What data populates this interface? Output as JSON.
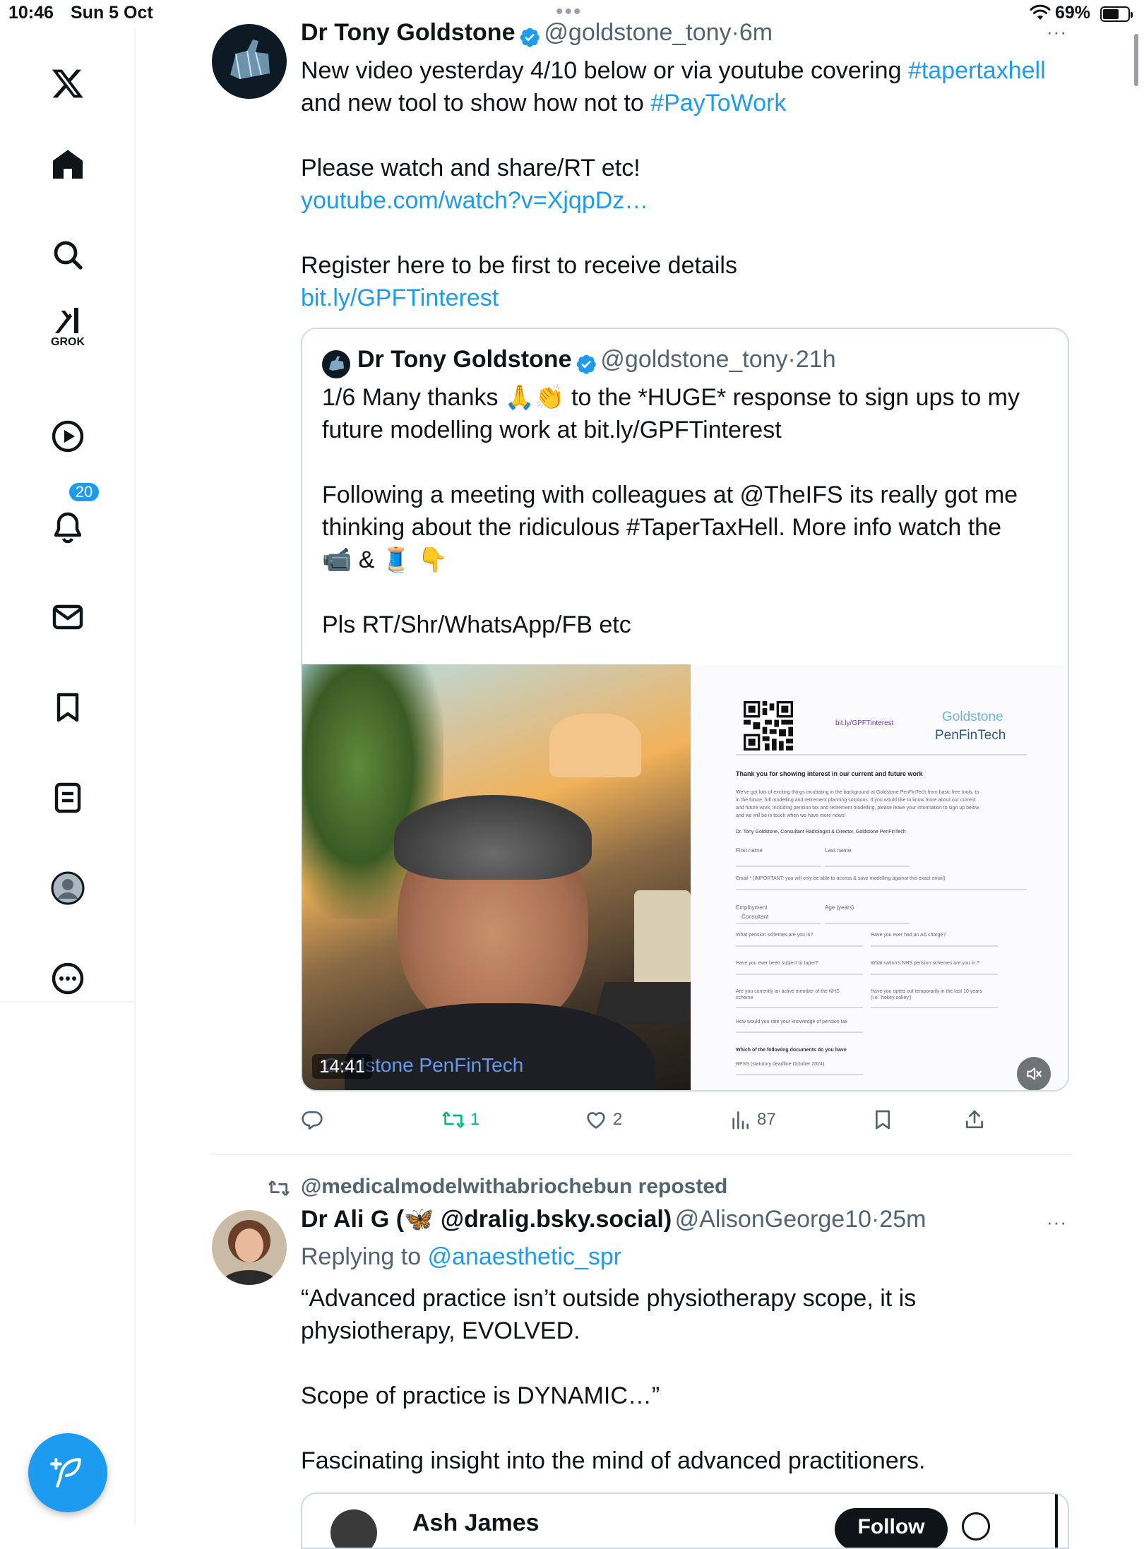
{
  "status_bar": {
    "time": "10:46",
    "date": "Sun 5 Oct",
    "battery": "69%",
    "battery_level": 0.69
  },
  "sidebar": {
    "items": [
      {
        "name": "x-logo"
      },
      {
        "name": "home"
      },
      {
        "name": "search"
      },
      {
        "name": "grok",
        "label": "GROK"
      },
      {
        "name": "video"
      },
      {
        "name": "notifications",
        "badge": "20"
      },
      {
        "name": "messages"
      },
      {
        "name": "bookmarks"
      },
      {
        "name": "lists"
      },
      {
        "name": "profile"
      },
      {
        "name": "more"
      }
    ]
  },
  "tweet1": {
    "name": "Dr Tony Goldstone",
    "handle": "@goldstone_tony",
    "sep": "·",
    "time": "6m",
    "more": "···",
    "line1": "New video yesterday 4/10 below or via youtube covering ",
    "hashtag1": "#tapertaxhell",
    "line2": "and new tool to show how not to ",
    "hashtag2": "#PayToWork",
    "line3": "Please watch and share/RT etc!",
    "link1": "youtube.com/watch?v=XjqpDz…",
    "line4": "Register here to be first to receive details",
    "link2": "bit.ly/GPFTinterest",
    "quote": {
      "name": "Dr Tony Goldstone",
      "handle": "@goldstone_tony",
      "sep": "·",
      "time": "21h",
      "p1a": "1/6 Many thanks 🙏👏 to the *HUGE* response to sign ups to my",
      "p1b": "future modelling work at bit.ly/GPFTinterest",
      "p2a": "Following a meeting with colleagues at @TheIFS its really got me",
      "p2b": "thinking about the ridiculous #TaperTaxHell. More info watch the",
      "p2c": "📹 & 🧵 👇",
      "p3": "Pls RT/Shr/WhatsApp/FB etc",
      "video_duration": "14:41",
      "video_watermark": "Goldstone PenFinTech",
      "form": {
        "qr_link": "bit.ly/GPFTinterest",
        "brand1": "Goldstone",
        "brand2": "PenFinTech",
        "heading": "Thank you for showing interest in our current and future work",
        "intro1": "We've got lots of exciting things incubating in the background at Goldstone PenFinTech from basic free tools, to",
        "intro2": "in the future, full modelling and retirement planning solutions. If you would like to know more about our current",
        "intro3": "and future work, including pension tax and retirement modelling, please leave your information to sign up below",
        "intro4": "and we will be in touch when we have more news!",
        "signature": "Dr. Tony Goldstone, Consultant Radiologist & Director, Goldstone PenFinTech",
        "first_name": "First name",
        "last_name": "Last name",
        "email": "Email * (IMPORTANT: you will only be able to access & save modelling against this exact email)",
        "employment": "Employment",
        "employment_value": "Consultant",
        "age": "Age (years)",
        "q1": "What pension schemes are you in?",
        "q2": "Have you ever had an AA charge?",
        "q3": "Have you ever been subject to taper?",
        "q4": "What nation's NHS pension schemes are you in ?",
        "q5a": "Are you currently an active member of the NHS",
        "q5b": "scheme",
        "q6a": "Have you opted out temporarily in the last 10 years",
        "q6b": "(i.e. 'hokey cokey')",
        "q7": "How would you rate your knowledge of pension tax",
        "q8": "Which of the following documents do you have",
        "q9": "RPSS (statutory deadline October 2024)"
      }
    },
    "actions": {
      "reply": "",
      "retweet": "1",
      "like": "2",
      "views": "87"
    },
    "colors": {
      "retweet": "#00ba7c"
    }
  },
  "tweet2": {
    "repost_by": "@medicalmodelwithabriochebun reposted",
    "name": "Dr Ali G (🦋 @dralig.bsky.social)",
    "handle": "@AlisonGeorge10",
    "sep": "·",
    "time": "25m",
    "more": "···",
    "replying_prefix": "Replying to ",
    "replying_to": "@anaesthetic_spr",
    "l1": "“Advanced practice isn’t outside physiotherapy scope, it is",
    "l2": "physiotherapy, EVOLVED.",
    "l3": "Scope of practice is DYNAMIC…”",
    "l4": "Fascinating insight into the mind of advanced practitioners.",
    "quote": {
      "name": "Ash James",
      "follow": "Follow"
    }
  },
  "colors": {
    "accent": "#1d9bf0",
    "text": "#0f1419",
    "muted": "#536471"
  }
}
